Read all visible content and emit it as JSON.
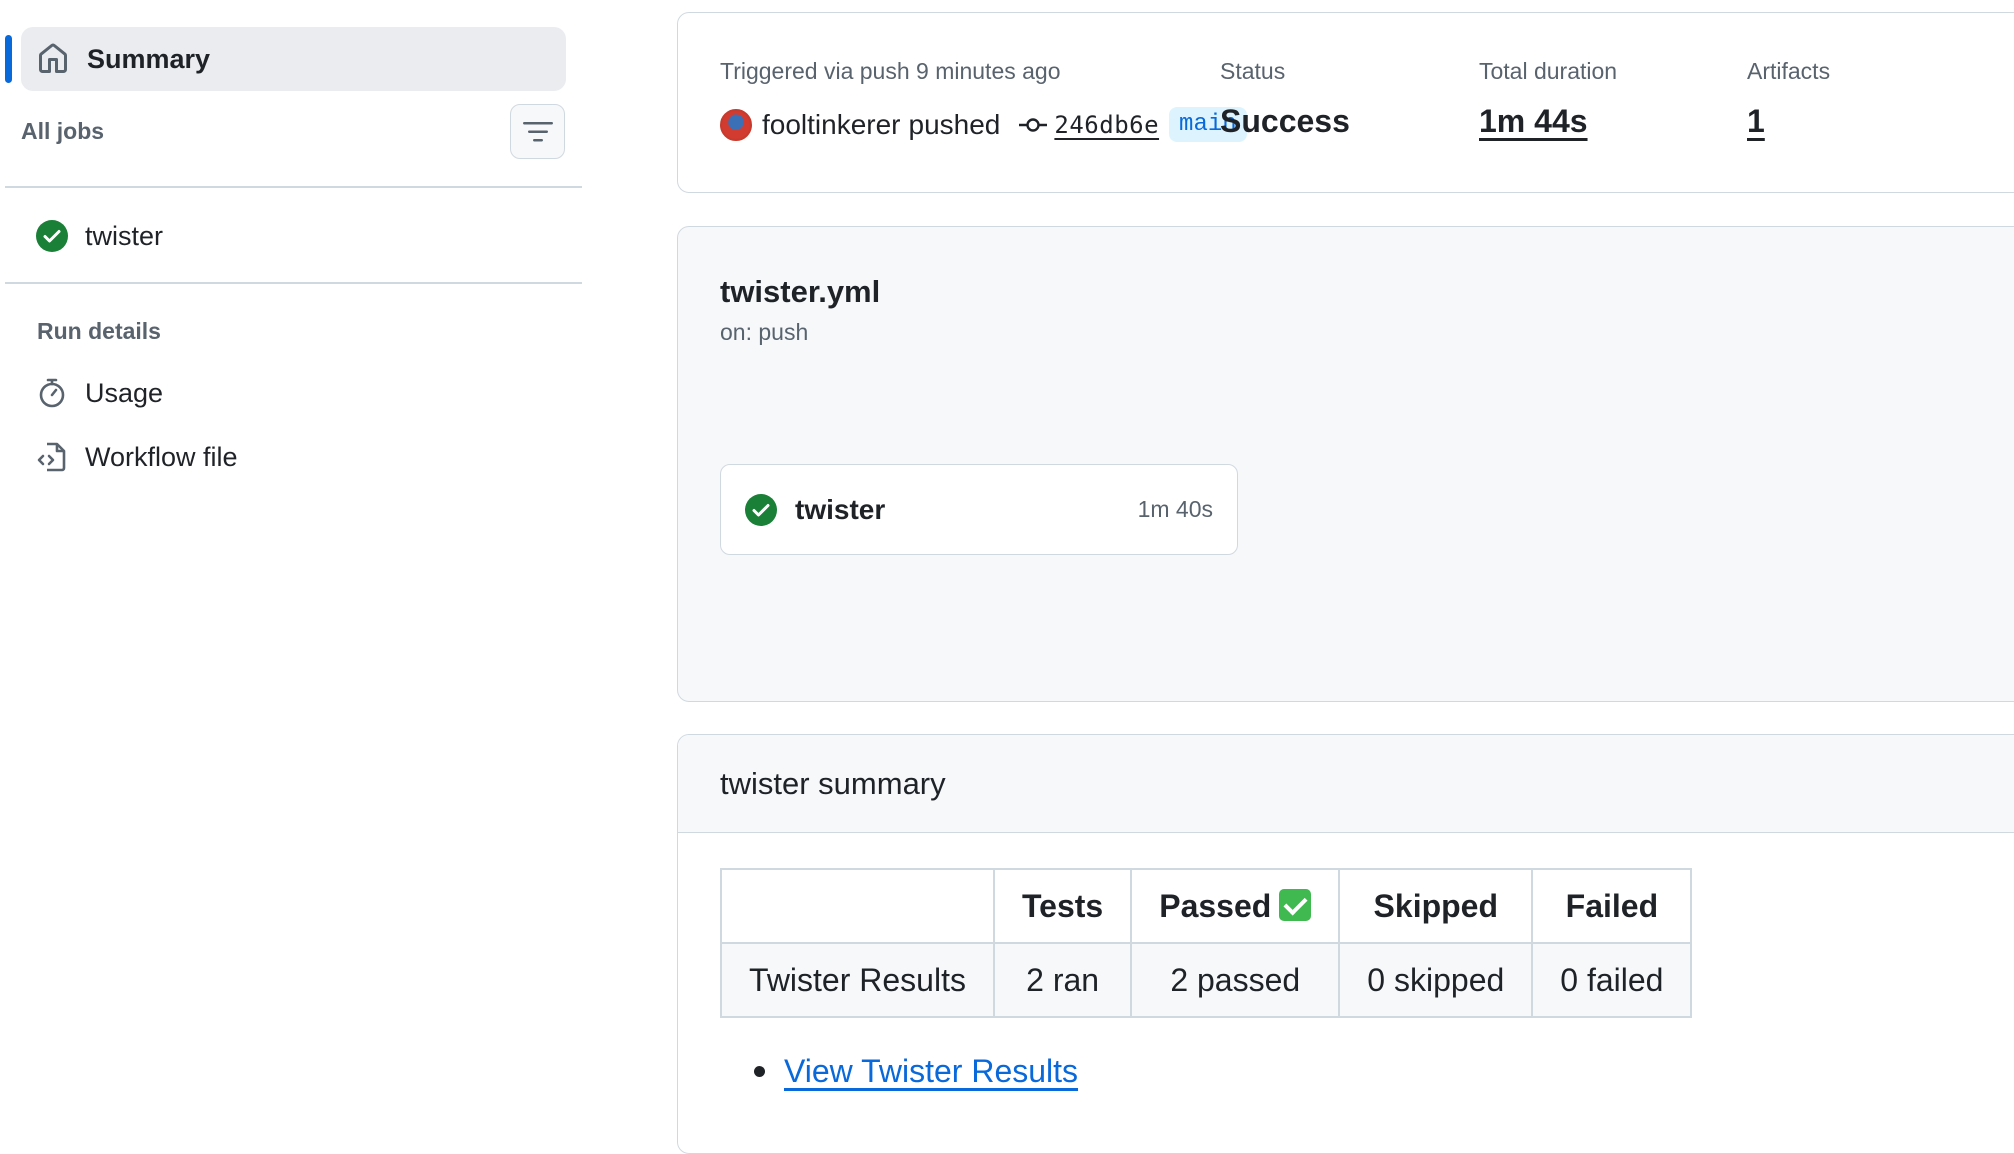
{
  "sidebar": {
    "summary_label": "Summary",
    "all_jobs_label": "All jobs",
    "jobs": [
      {
        "label": "twister",
        "status": "success"
      }
    ],
    "run_details_label": "Run details",
    "run_details": [
      {
        "label": "Usage",
        "icon": "stopwatch-icon"
      },
      {
        "label": "Workflow file",
        "icon": "file-code-icon"
      }
    ]
  },
  "run": {
    "trigger_text": "Triggered via push 9 minutes ago",
    "actor": "fooltinkerer",
    "action": "pushed",
    "commit_sha": "246db6e",
    "branch": "main",
    "status_label": "Status",
    "status_value": "Success",
    "duration_label": "Total duration",
    "duration_value": "1m 44s",
    "artifacts_label": "Artifacts",
    "artifacts_value": "1"
  },
  "workflow": {
    "file": "twister.yml",
    "trigger": "on: push",
    "job": {
      "name": "twister",
      "duration": "1m 40s"
    }
  },
  "summary": {
    "title": "twister summary",
    "table": {
      "headers": [
        "",
        "Tests",
        "Passed",
        "Skipped",
        "Failed"
      ],
      "rows": [
        [
          "Twister Results",
          "2 ran",
          "2 passed",
          "0 skipped",
          "0 failed"
        ]
      ]
    },
    "link_text": "View Twister Results"
  },
  "colors": {
    "accent": "#0969da",
    "success": "#1a7f37",
    "border": "#d1d9e0",
    "muted": "#59636e"
  }
}
